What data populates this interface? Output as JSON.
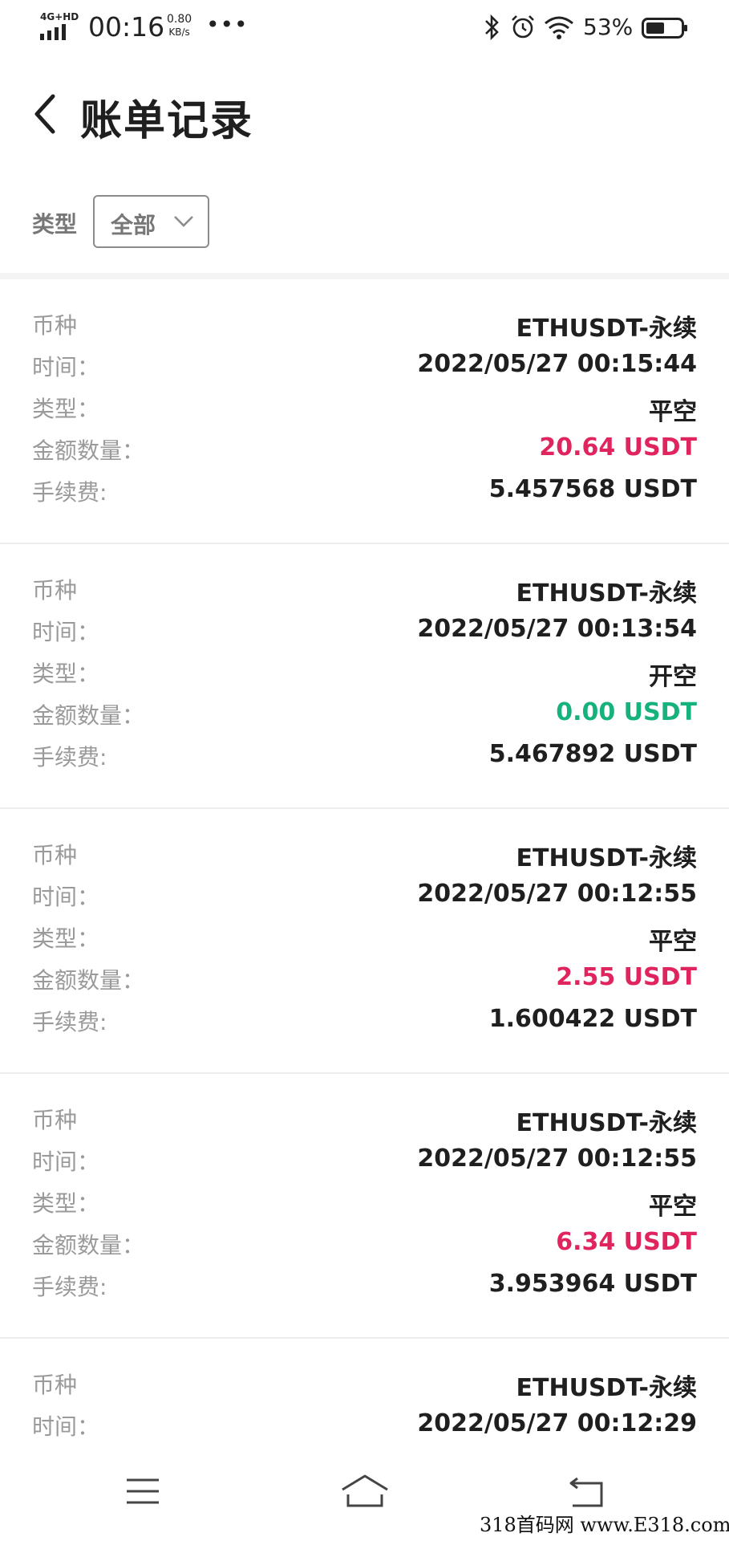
{
  "status_bar": {
    "network": "4G+HD",
    "time": "00:16",
    "speed_value": "0.80",
    "speed_unit": "KB/s",
    "more": "•••",
    "battery": "53%"
  },
  "header": {
    "title": "账单记录"
  },
  "filter": {
    "label": "类型",
    "selected": "全部"
  },
  "records": [
    {
      "coin_label": "币种",
      "coin": "ETHUSDT-永续",
      "time_label": "时间：",
      "time": "2022/05/27 00:15:44",
      "type_label": "类型：",
      "type": "平空",
      "amount_label": "金额数量：",
      "amount": "20.64 USDT",
      "amount_color": "#e0245e",
      "fee_label": "手续费:",
      "fee": "5.457568 USDT"
    },
    {
      "coin_label": "币种",
      "coin": "ETHUSDT-永续",
      "time_label": "时间：",
      "time": "2022/05/27 00:13:54",
      "type_label": "类型：",
      "type": "开空",
      "amount_label": "金额数量：",
      "amount": "0.00 USDT",
      "amount_color": "#16b27c",
      "fee_label": "手续费:",
      "fee": "5.467892 USDT"
    },
    {
      "coin_label": "币种",
      "coin": "ETHUSDT-永续",
      "time_label": "时间：",
      "time": "2022/05/27 00:12:55",
      "type_label": "类型：",
      "type": "平空",
      "amount_label": "金额数量：",
      "amount": "2.55 USDT",
      "amount_color": "#e0245e",
      "fee_label": "手续费:",
      "fee": "1.600422 USDT"
    },
    {
      "coin_label": "币种",
      "coin": "ETHUSDT-永续",
      "time_label": "时间：",
      "time": "2022/05/27 00:12:55",
      "type_label": "类型：",
      "type": "平空",
      "amount_label": "金额数量：",
      "amount": "6.34 USDT",
      "amount_color": "#e0245e",
      "fee_label": "手续费:",
      "fee": "3.953964 USDT"
    },
    {
      "coin_label": "币种",
      "coin": "ETHUSDT-永续",
      "time_label": "时间：",
      "time": "2022/05/27 00:12:29"
    }
  ],
  "nav_bar": {
    "icons": [
      "menu-icon",
      "home-icon",
      "back-icon"
    ]
  },
  "watermark": "318首码网 www.E318.com"
}
